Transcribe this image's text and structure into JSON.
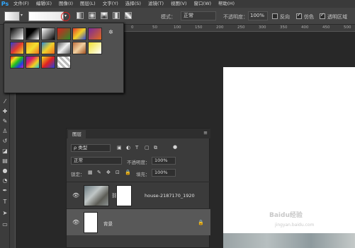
{
  "app": {
    "logo": "Ps"
  },
  "menu": [
    "文件(F)",
    "编辑(E)",
    "图像(I)",
    "图层(L)",
    "文字(Y)",
    "选择(S)",
    "滤镜(T)",
    "视图(V)",
    "窗口(W)",
    "帮助(H)"
  ],
  "options": {
    "mode_label": "模式：",
    "mode_value": "正常",
    "opacity_label": "不透明度：",
    "opacity_value": "100%",
    "reverse_label": "反向",
    "dither_label": "仿色",
    "transparency_label": "透明区域",
    "reverse_checked": false,
    "dither_checked": true,
    "transparency_checked": true
  },
  "ruler": {
    "marks": [
      "",
      "0",
      "50",
      "100",
      "150",
      "200",
      "250",
      "300",
      "350",
      "400",
      "450",
      "500"
    ]
  },
  "gradient_panel": {
    "gear": "✲"
  },
  "layers": {
    "tab_label": "图层",
    "filter_label": "ρ 类型",
    "blend_mode": "正常",
    "opacity_label": "不透明度：",
    "opacity_value": "100%",
    "lock_label": "锁定：",
    "fill_label": "填充：",
    "fill_value": "100%",
    "items": [
      {
        "name": "house-2187170_1920",
        "active": false
      },
      {
        "name": "背景",
        "active": true
      }
    ]
  },
  "watermark": {
    "title": "Baidu经验",
    "url": "jingyan.baidu.com"
  }
}
